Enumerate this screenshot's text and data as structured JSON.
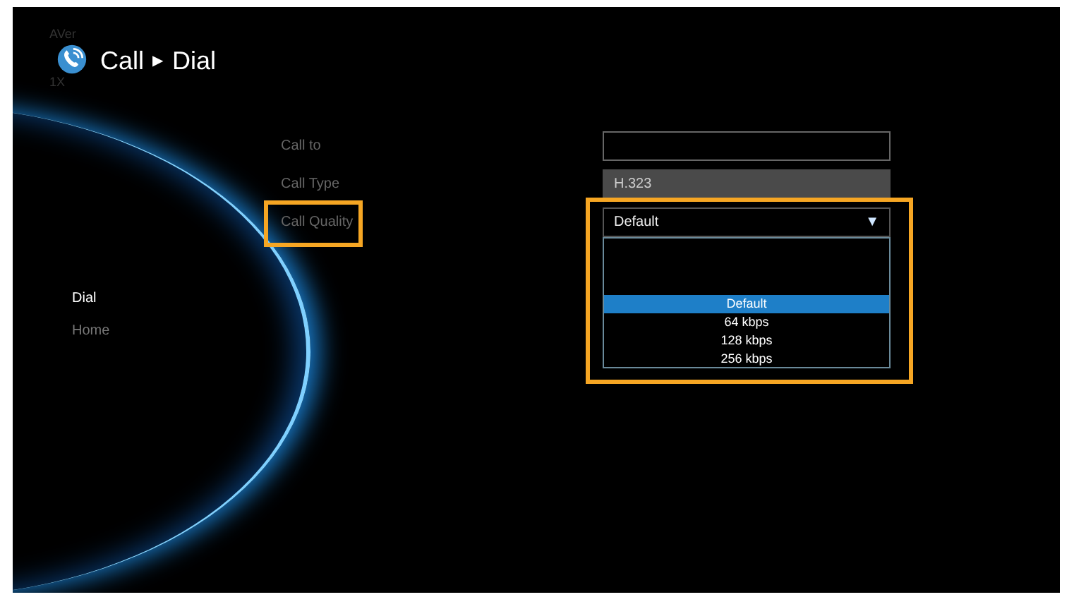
{
  "header": {
    "logo_text": "AVer",
    "logo_subtext": "1X",
    "breadcrumb": [
      {
        "label": "Call"
      },
      {
        "label": "Dial"
      }
    ],
    "separator": "▶"
  },
  "sidebar": {
    "items": [
      {
        "label": "Dial",
        "selected": true
      },
      {
        "label": "Home",
        "selected": false
      }
    ]
  },
  "form": {
    "fields": [
      {
        "kind": "text",
        "label": "Call to",
        "highlighted": false
      },
      {
        "kind": "readonly",
        "label": "Call Type",
        "value": "H.323",
        "highlighted": false
      },
      {
        "kind": "dropdown",
        "label": "Call Quality",
        "value": "Default",
        "highlighted": true,
        "expanded": true,
        "arrow": "▼",
        "options": [
          {
            "label": "Default",
            "selected": true
          },
          {
            "label": "64 kbps",
            "selected": false
          },
          {
            "label": "128 kbps",
            "selected": false
          },
          {
            "label": "256 kbps",
            "selected": false
          }
        ]
      }
    ]
  }
}
